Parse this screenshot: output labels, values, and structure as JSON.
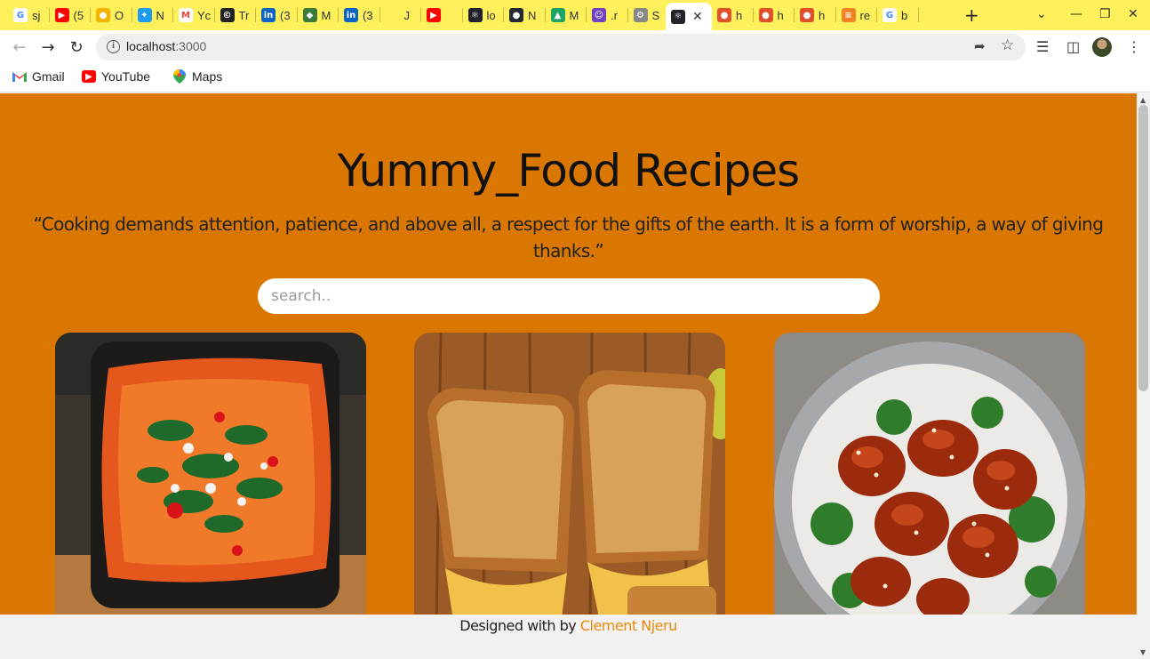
{
  "browser": {
    "tabs": [
      {
        "label": "sj",
        "icon": "google-icon",
        "color": "#ffffff"
      },
      {
        "label": "(5",
        "icon": "youtube-icon",
        "color": "#ff0000"
      },
      {
        "label": "O",
        "icon": "cheese-icon",
        "color": "#f5b400"
      },
      {
        "label": "N",
        "icon": "twitter-icon",
        "color": "#1d9bf0"
      },
      {
        "label": "Yc",
        "icon": "gmail-icon",
        "color": "#ffffff"
      },
      {
        "label": "Tr",
        "icon": "copyright-icon",
        "color": "#222222"
      },
      {
        "label": "(3",
        "icon": "linkedin-icon",
        "color": "#0a66c2"
      },
      {
        "label": "M",
        "icon": "frog-icon",
        "color": "#3b7a3b"
      },
      {
        "label": "(3",
        "icon": "linkedin-icon",
        "color": "#0a66c2"
      },
      {
        "label": "J",
        "icon": "blank-icon",
        "color": "#fdf05a"
      },
      {
        "label": "",
        "icon": "youtube-icon",
        "color": "#ff0000"
      },
      {
        "label": "lo",
        "icon": "react-icon",
        "color": "#20232a"
      },
      {
        "label": "N",
        "icon": "github-icon",
        "color": "#24292f"
      },
      {
        "label": "M",
        "icon": "drive-icon",
        "color": "#1fa463"
      },
      {
        "label": ".r",
        "icon": "robot-icon",
        "color": "#6f42c1"
      },
      {
        "label": "S",
        "icon": "settings-icon",
        "color": "#888888"
      },
      {
        "label": "",
        "icon": "react-icon",
        "color": "#20232a",
        "active": true
      },
      {
        "label": "h",
        "icon": "food-icon",
        "color": "#e0502a"
      },
      {
        "label": "h",
        "icon": "food-icon",
        "color": "#e0502a"
      },
      {
        "label": "h",
        "icon": "food-icon",
        "color": "#e0502a"
      },
      {
        "label": "re",
        "icon": "stack-icon",
        "color": "#f48024"
      },
      {
        "label": "b",
        "icon": "google-icon",
        "color": "#ffffff"
      }
    ],
    "url_host": "localhost",
    "url_port": ":3000",
    "bookmarks": [
      {
        "label": "Gmail",
        "icon": "gmail-icon"
      },
      {
        "label": "YouTube",
        "icon": "youtube-icon"
      },
      {
        "label": "Maps",
        "icon": "maps-icon"
      }
    ]
  },
  "page": {
    "title": "Yummy_Food Recipes",
    "quote": "“Cooking demands attention, patience, and above all, a respect for the gifts of the earth. It is a form of worship, a way of giving thanks.”",
    "search_placeholder": "search..",
    "background_color": "#d97702",
    "cards": [
      {
        "image": "shakshuka-skillet-photo"
      },
      {
        "image": "grilled-mac-and-cheese-sandwich-photo"
      },
      {
        "image": "glazed-chicken-rice-bowl-photo"
      }
    ]
  },
  "footer": {
    "prefix": "Designed with by",
    "author": "Clement Njeru",
    "author_color": "#e88a0c"
  }
}
